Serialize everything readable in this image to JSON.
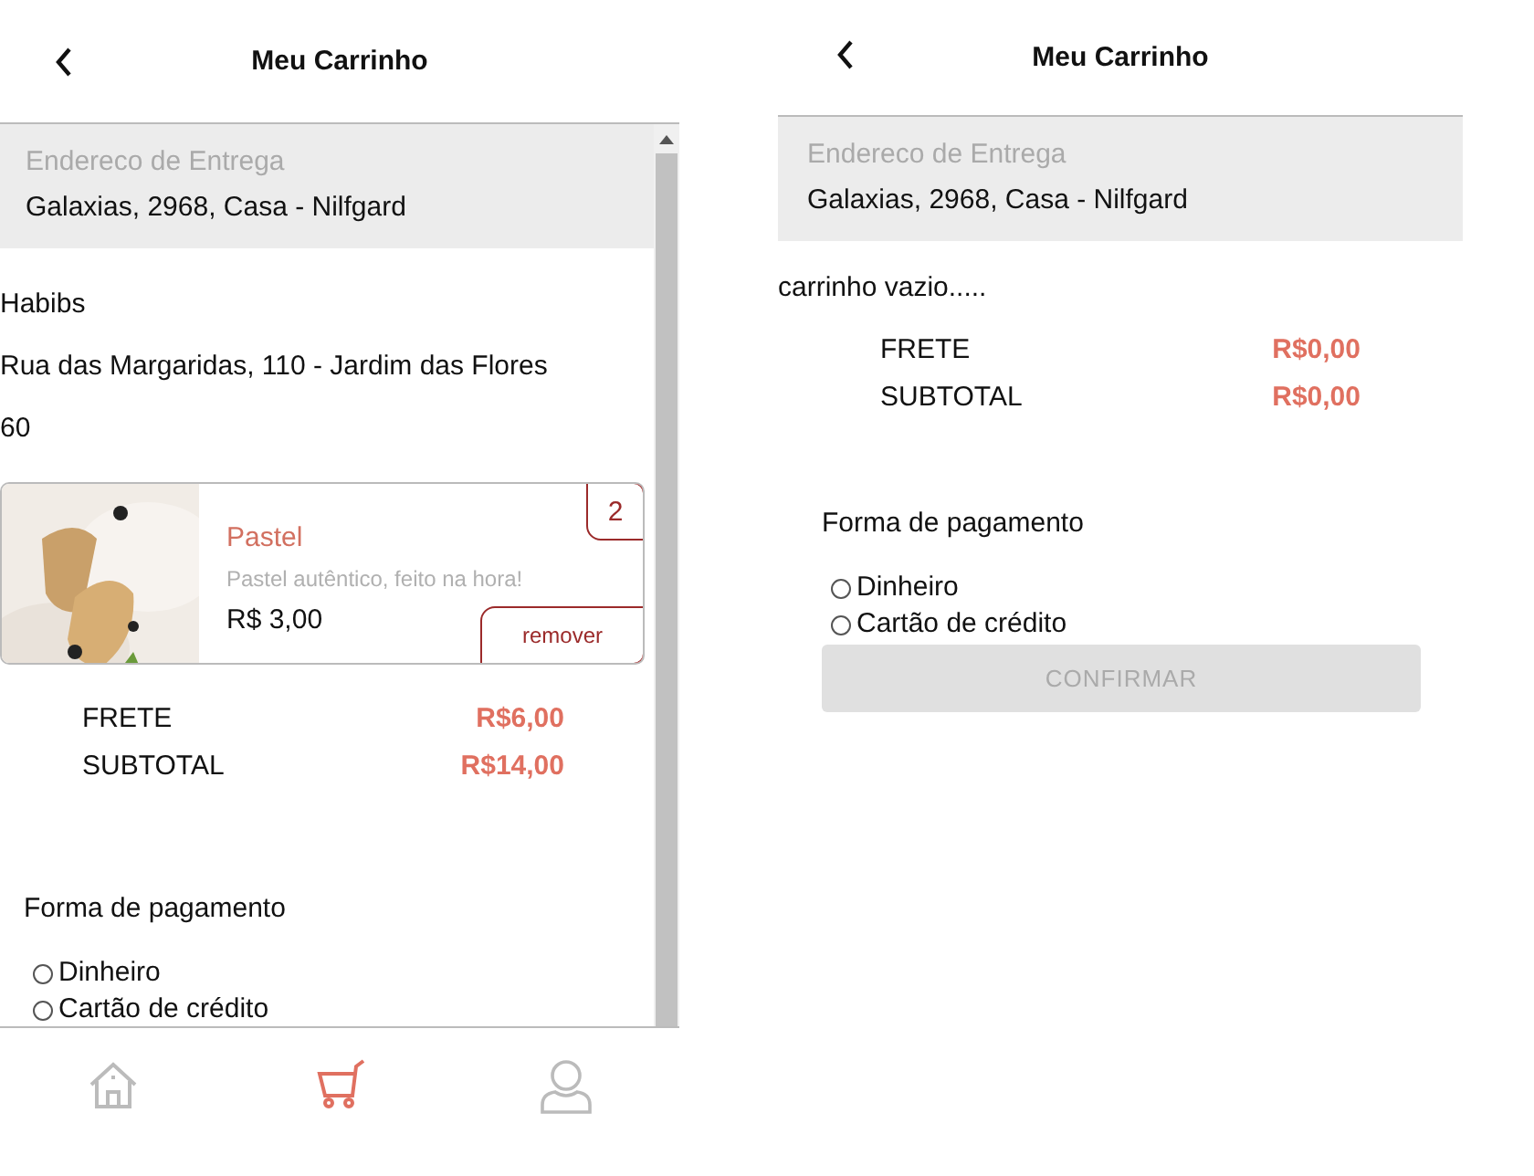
{
  "screens": [
    {
      "header": {
        "title": "Meu Carrinho"
      },
      "address": {
        "label": "Endereco de Entrega",
        "value": "Galaxias, 2968, Casa - Nilfgard"
      },
      "restaurant": {
        "name": "Habibs",
        "address": "Rua das Margaridas, 110 - Jardim das Flores",
        "value": "60"
      },
      "items": [
        {
          "kind": "picture",
          "name": "Pastel",
          "description": "Pastel autêntico, feito na hora!",
          "price": "R$ 3,00",
          "quantity": "2",
          "action": "remover"
        }
      ],
      "totals": [
        {
          "label": "FRETE",
          "value": "R$6,00"
        },
        {
          "label": "SUBTOTAL",
          "value": "R$14,00"
        }
      ],
      "payment": {
        "title": "Forma de pagamento",
        "options": [
          {
            "label": "Dinheiro",
            "checked": false
          },
          {
            "label": "Cartão de crédito",
            "checked": false
          }
        ]
      },
      "nav": [
        {
          "kind": "home",
          "selected": false
        },
        {
          "kind": "cart",
          "selected": true
        },
        {
          "kind": "profile",
          "selected": false
        }
      ]
    },
    {
      "header": {
        "title": "Meu Carrinho"
      },
      "address": {
        "label": "Endereco de Entrega",
        "value": "Galaxias, 2968, Casa - Nilfgard"
      },
      "empty_message": "carrinho vazio.....",
      "totals": [
        {
          "label": "FRETE",
          "value": "R$0,00"
        },
        {
          "label": "SUBTOTAL",
          "value": "R$0,00"
        }
      ],
      "payment": {
        "title": "Forma de pagamento",
        "options": [
          {
            "label": "Dinheiro",
            "checked": false
          },
          {
            "label": "Cartão de crédito",
            "checked": false
          }
        ]
      },
      "confirm": {
        "label": "CONFIRMAR",
        "disabled": true
      }
    }
  ]
}
